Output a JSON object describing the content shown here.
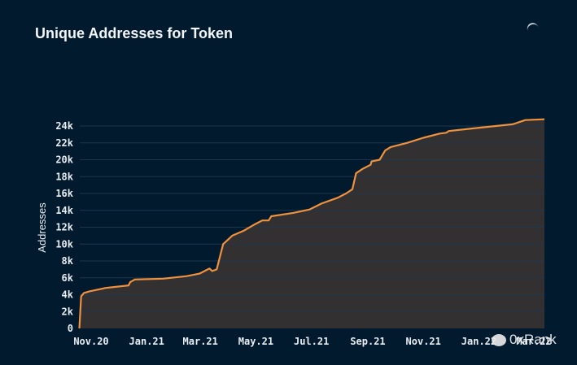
{
  "title": "Unique Addresses for Token",
  "watermark": "0xRank",
  "colors": {
    "background": "#011a2e",
    "line": "#f0913e",
    "area": "#333031",
    "grid": "#1d3a52"
  },
  "icons": {
    "loading": "spinner-icon",
    "watermark": "wechat-icon"
  },
  "chart_data": {
    "type": "area",
    "title": "Unique Addresses for Token",
    "xlabel": "",
    "ylabel": "Addresses",
    "ylim": [
      0,
      24000
    ],
    "grid": true,
    "y_ticks": [
      {
        "v": 0,
        "label": "0"
      },
      {
        "v": 2000,
        "label": "2k"
      },
      {
        "v": 4000,
        "label": "4k"
      },
      {
        "v": 6000,
        "label": "6k"
      },
      {
        "v": 8000,
        "label": "8k"
      },
      {
        "v": 10000,
        "label": "10k"
      },
      {
        "v": 12000,
        "label": "12k"
      },
      {
        "v": 14000,
        "label": "14k"
      },
      {
        "v": 16000,
        "label": "16k"
      },
      {
        "v": 18000,
        "label": "18k"
      },
      {
        "v": 20000,
        "label": "20k"
      },
      {
        "v": 22000,
        "label": "22k"
      },
      {
        "v": 24000,
        "label": "24k"
      }
    ],
    "x_ticks": [
      {
        "d": "2020-11-01",
        "label": "Nov.20"
      },
      {
        "d": "2021-01-01",
        "label": "Jan.21"
      },
      {
        "d": "2021-03-01",
        "label": "Mar.21"
      },
      {
        "d": "2021-05-01",
        "label": "May.21"
      },
      {
        "d": "2021-07-01",
        "label": "Jul.21"
      },
      {
        "d": "2021-09-01",
        "label": "Sep.21"
      },
      {
        "d": "2021-11-01",
        "label": "Nov.21"
      },
      {
        "d": "2022-01-01",
        "label": "Jan.22"
      },
      {
        "d": "2022-03-01",
        "label": "Mar.22"
      }
    ],
    "series": [
      {
        "points": [
          [
            "2020-10-19",
            0
          ],
          [
            "2020-10-21",
            3800
          ],
          [
            "2020-10-24",
            4200
          ],
          [
            "2020-10-30",
            4400
          ],
          [
            "2020-11-17",
            4800
          ],
          [
            "2020-12-12",
            5100
          ],
          [
            "2020-12-14",
            5500
          ],
          [
            "2020-12-19",
            5800
          ],
          [
            "2021-01-19",
            5900
          ],
          [
            "2021-02-14",
            6200
          ],
          [
            "2021-02-28",
            6500
          ],
          [
            "2021-03-11",
            7100
          ],
          [
            "2021-03-14",
            6800
          ],
          [
            "2021-03-19",
            7000
          ],
          [
            "2021-03-22",
            8300
          ],
          [
            "2021-03-26",
            10000
          ],
          [
            "2021-04-05",
            11000
          ],
          [
            "2021-04-18",
            11600
          ],
          [
            "2021-04-29",
            12300
          ],
          [
            "2021-05-08",
            12800
          ],
          [
            "2021-05-15",
            12800
          ],
          [
            "2021-05-18",
            13300
          ],
          [
            "2021-06-11",
            13700
          ],
          [
            "2021-06-29",
            14100
          ],
          [
            "2021-07-12",
            14800
          ],
          [
            "2021-07-30",
            15500
          ],
          [
            "2021-08-08",
            16000
          ],
          [
            "2021-08-15",
            16500
          ],
          [
            "2021-08-19",
            18400
          ],
          [
            "2021-08-26",
            18900
          ],
          [
            "2021-09-04",
            19400
          ],
          [
            "2021-09-05",
            19800
          ],
          [
            "2021-09-14",
            20000
          ],
          [
            "2021-09-20",
            21100
          ],
          [
            "2021-09-26",
            21500
          ],
          [
            "2021-10-14",
            22000
          ],
          [
            "2021-11-01",
            22600
          ],
          [
            "2021-11-19",
            23100
          ],
          [
            "2021-11-26",
            23200
          ],
          [
            "2021-11-29",
            23400
          ],
          [
            "2021-12-24",
            23700
          ],
          [
            "2022-01-11",
            23900
          ],
          [
            "2022-02-07",
            24200
          ],
          [
            "2022-02-21",
            24700
          ],
          [
            "2022-03-14",
            24800
          ]
        ]
      }
    ]
  }
}
